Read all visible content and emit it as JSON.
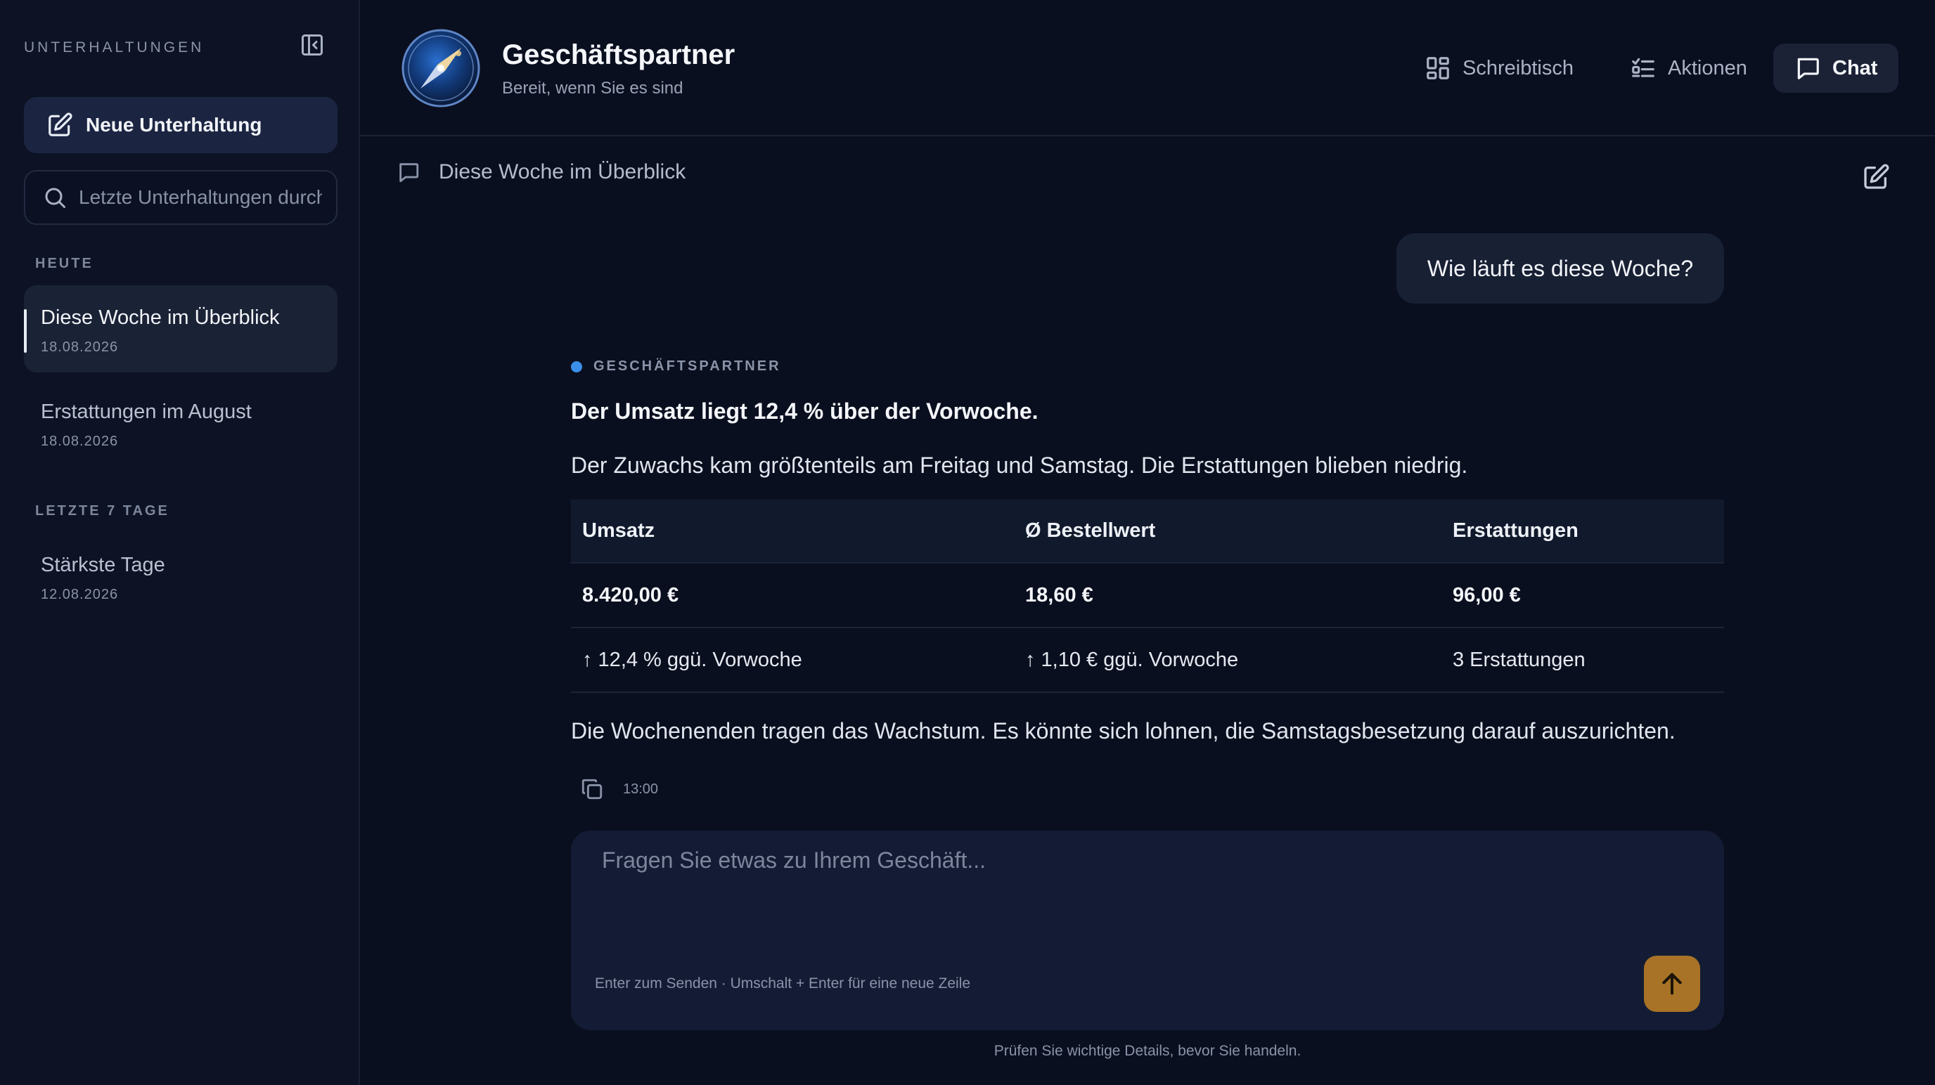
{
  "sidebar": {
    "title": "UNTERHALTUNGEN",
    "new_chat_label": "Neue Unterhaltung",
    "search_placeholder": "Letzte Unterhaltungen durchsuchen",
    "sections": [
      {
        "label": "HEUTE",
        "items": [
          {
            "title": "Diese Woche im Überblick",
            "date": "18.08.2026",
            "active": true
          },
          {
            "title": "Erstattungen im August",
            "date": "18.08.2026",
            "active": false
          }
        ]
      },
      {
        "label": "LETZTE 7 TAGE",
        "items": [
          {
            "title": "Stärkste Tage",
            "date": "12.08.2026",
            "active": false
          }
        ]
      }
    ]
  },
  "header": {
    "title": "Geschäftspartner",
    "subtitle": "Bereit, wenn Sie es sind",
    "nav": [
      {
        "label": "Schreibtisch",
        "icon": "grid-icon",
        "active": false
      },
      {
        "label": "Aktionen",
        "icon": "checklist-icon",
        "active": false
      },
      {
        "label": "Chat",
        "icon": "chat-bubble-icon",
        "active": true
      }
    ]
  },
  "conversation": {
    "title": "Diese Woche im Überblick",
    "user_message": "Wie läuft es diese Woche?",
    "assistant": {
      "label": "GESCHÄFTSPARTNER",
      "headline": "Der Umsatz liegt 12,4 % über der Vorwoche.",
      "paragraph1": "Der Zuwachs kam größtenteils am Freitag und Samstag. Die Erstattungen blieben niedrig.",
      "table": {
        "headers": [
          "Umsatz",
          "Ø Bestellwert",
          "Erstattungen"
        ],
        "values": [
          "8.420,00 €",
          "18,60 €",
          "96,00 €"
        ],
        "changes": [
          "↑ 12,4 % ggü. Vorwoche",
          "↑ 1,10 € ggü. Vorwoche",
          "3 Erstattungen"
        ]
      },
      "paragraph2": "Die Wochenenden tragen das Wachstum. Es könnte sich lohnen, die Samstagsbesetzung darauf auszurichten.",
      "time": "13:00"
    }
  },
  "composer": {
    "placeholder": "Fragen Sie etwas zu Ihrem Geschäft...",
    "hint": "Enter zum Senden · Umschalt + Enter für eine neue Zeile"
  },
  "footer_note": "Prüfen Sie wichtige Details, bevor Sie handeln.",
  "colors": {
    "background": "#0a0f1f",
    "sidebar": "#0d1324",
    "accent_blue": "#3b8fe8",
    "send_button": "#a87326"
  }
}
